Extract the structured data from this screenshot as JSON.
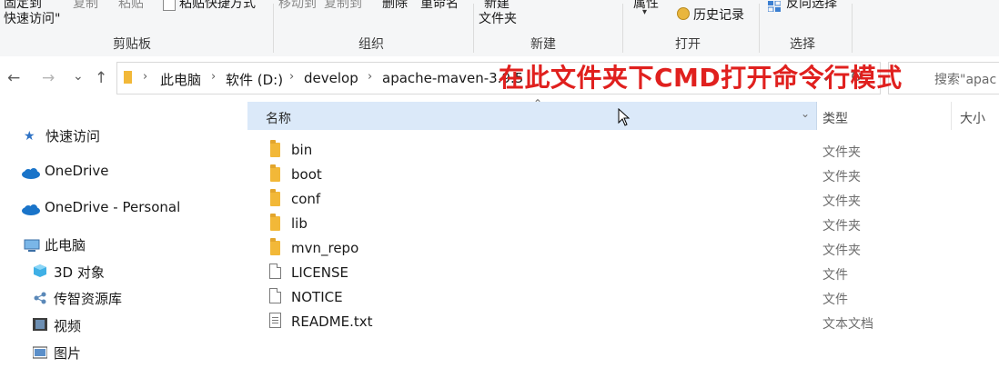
{
  "ribbon": {
    "clipboard": {
      "label": "剪贴板",
      "pin_quick": "固定到",
      "pin_quick2": "快速访问\"",
      "copy": "复制",
      "paste": "粘贴",
      "paste_shortcut": "粘贴快捷方式"
    },
    "organize": {
      "label": "组织",
      "move_to": "移动到",
      "copy_to": "复制到",
      "delete": "删除",
      "rename": "重命名"
    },
    "new": {
      "label": "新建",
      "new_item": "新建",
      "new_folder": "文件夹"
    },
    "open": {
      "label": "打开",
      "properties": "属性",
      "history": "历史记录"
    },
    "select": {
      "label": "选择",
      "invert": "反向选择"
    }
  },
  "nav_buttons": {
    "back": "←",
    "forward": "→",
    "recent": "⌄",
    "up": "↑"
  },
  "breadcrumb": [
    "此电脑",
    "软件 (D:)",
    "develop",
    "apache-maven-3.9.5"
  ],
  "search": {
    "placeholder": "搜索\"apac"
  },
  "annotation": "在此文件夹下CMD打开命令行模式",
  "sidebar": {
    "quick_access": "快速访问",
    "onedrive": "OneDrive",
    "onedrive_personal": "OneDrive - Personal",
    "this_pc": "此电脑",
    "objects_3d": "3D 对象",
    "chuanzhi": "传智资源库",
    "videos": "视频",
    "pictures": "图片"
  },
  "columns": {
    "name": "名称",
    "type": "类型",
    "size": "大小"
  },
  "files": [
    {
      "name": "bin",
      "type": "文件夹",
      "icon": "folder-icon"
    },
    {
      "name": "boot",
      "type": "文件夹",
      "icon": "folder-icon"
    },
    {
      "name": "conf",
      "type": "文件夹",
      "icon": "folder-icon"
    },
    {
      "name": "lib",
      "type": "文件夹",
      "icon": "folder-icon"
    },
    {
      "name": "mvn_repo",
      "type": "文件夹",
      "icon": "folder-icon"
    },
    {
      "name": "LICENSE",
      "type": "文件",
      "icon": "file-icon"
    },
    {
      "name": "NOTICE",
      "type": "文件",
      "icon": "file-icon"
    },
    {
      "name": "README.txt",
      "type": "文本文档",
      "icon": "text-file-icon"
    }
  ],
  "colors": {
    "annotation": "#e0201e",
    "header_highlight": "#dbe9f9",
    "folder": "#f2b838",
    "onedrive": "#1a74c9"
  }
}
